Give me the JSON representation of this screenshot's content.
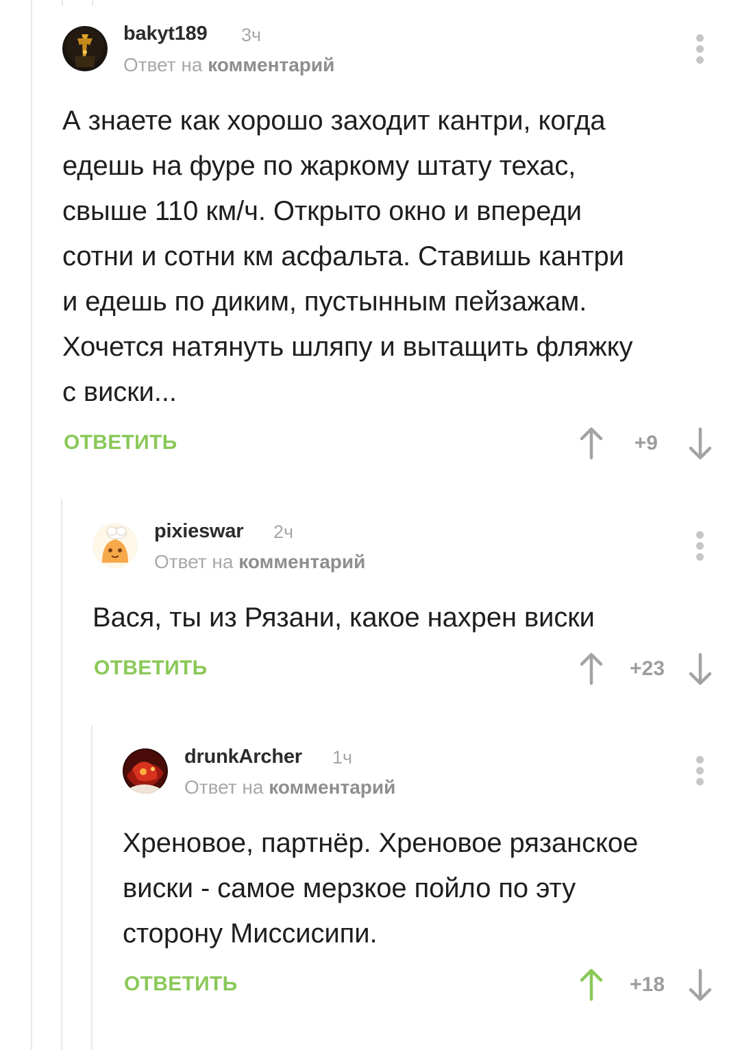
{
  "reply_prefix": "Ответ на",
  "reply_target": "комментарий",
  "colors": {
    "accent_green": "#8ac858",
    "vote_gray": "#9d9d9d",
    "meta_gray": "#a8a8a8"
  },
  "comments": [
    {
      "username": "bakyt189",
      "time": "3ч",
      "text": "А знаете как хорошо заходит кантри, когда\nедешь на фуре по жаркому штату техас,\nсвыше 110 км/ч. Открыто окно и впереди\nсотни и сотни км асфальта. Ставишь кантри\nи едешь по диким, пустынным пейзажам.\nХочется натянуть шляпу и вытащить фляжку\nс виски...",
      "reply_label": "ОТВЕТИТЬ",
      "rating": "+9",
      "upvoted": false,
      "avatar_icon": "dark-figure-avatar"
    },
    {
      "username": "pixieswar",
      "time": "2ч",
      "text": "Вася, ты из Рязани, какое нахрен виски",
      "reply_label": "ОТВЕТИТЬ",
      "rating": "+23",
      "upvoted": false,
      "avatar_icon": "cartoon-chef-avatar"
    },
    {
      "username": "drunkArcher",
      "time": "1ч",
      "text": "Хреновое, партнёр. Хреновое рязанское\nвиски - самое мерзкое пойло по эту\nсторону Миссисипи.",
      "reply_label": "ОТВЕТИТЬ",
      "rating": "+18",
      "upvoted": true,
      "avatar_icon": "red-creature-avatar"
    }
  ]
}
